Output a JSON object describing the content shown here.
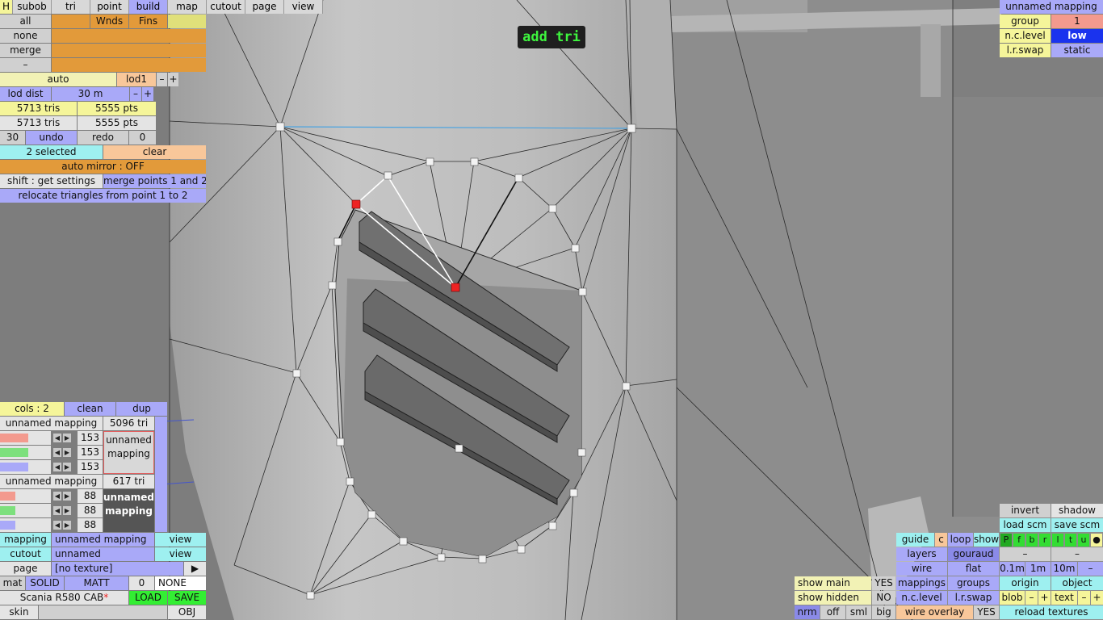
{
  "top_tabs": [
    {
      "label": "H",
      "w": 16
    },
    {
      "label": "subob",
      "w": 48
    },
    {
      "label": "tri",
      "w": 48
    },
    {
      "label": "point",
      "w": 48
    },
    {
      "label": "build",
      "w": 48
    },
    {
      "label": "map",
      "w": 48
    },
    {
      "label": "cutout",
      "w": 48
    },
    {
      "label": "page",
      "w": 48
    },
    {
      "label": "view",
      "w": 48
    }
  ],
  "active_tab": "build",
  "mode_banner": "add tri",
  "filter_rows": [
    {
      "label": "all",
      "c2": "Wnds",
      "c3": "Fins"
    },
    {
      "label": "none",
      "c2": "",
      "c3": ""
    },
    {
      "label": "merge",
      "c2": "",
      "c3": ""
    },
    {
      "label": "–",
      "c2": "",
      "c3": ""
    }
  ],
  "lod": {
    "auto": "auto",
    "level": "lod1",
    "minus": "–",
    "plus": "+",
    "dist_label": "lod dist",
    "dist_value": "30 m"
  },
  "stats": [
    {
      "tris": "5713 tris",
      "pts": "5555 pts"
    },
    {
      "tris": "5713 tris",
      "pts": "5555 pts"
    }
  ],
  "history": {
    "count": "30",
    "undo": "undo",
    "redo": "redo",
    "redo_count": "0"
  },
  "selection": {
    "selected": "2 selected",
    "clear": "clear"
  },
  "auto_mirror": "auto mirror : OFF",
  "shift_settings": "shift : get settings",
  "merge_points": "merge points 1 and 2",
  "relocate": "relocate triangles from point 1 to 2",
  "cols": {
    "label": "cols : 2",
    "clean": "clean",
    "dup": "dup"
  },
  "mapping_blocks": [
    {
      "name": "unnamed mapping",
      "tris": "5096 tri",
      "values": [
        "153",
        "153",
        "153"
      ],
      "preview": "unnamed\nmapping",
      "fills": [
        0.55,
        0.55,
        0.55
      ]
    },
    {
      "name": "unnamed mapping",
      "tris": "617 tri",
      "values": [
        "88",
        "88",
        "88"
      ],
      "preview": "unnamed\nmapping",
      "fills": [
        0.3,
        0.3,
        0.3
      ]
    }
  ],
  "bottom_left": {
    "mapping_label": "mapping",
    "mapping_value": "unnamed mapping",
    "view": "view",
    "cutout_label": "cutout",
    "cutout_value": "unnamed",
    "view2": "view",
    "page_label": "page",
    "page_value": "[no texture]",
    "page_arrow": "▶",
    "mat": "mat",
    "solid": "SOLID",
    "matt": "MATT",
    "mat_num": "0",
    "none": "NONE",
    "model": "Scania R580 CAB",
    "load": "LOAD",
    "save": "SAVE",
    "skin": "skin",
    "obj": "OBJ"
  },
  "top_right": {
    "title": "unnamed mapping",
    "group_label": "group",
    "group_value": "1",
    "nclevel_label": "n.c.level",
    "nclevel_value": "low",
    "lrswap_label": "l.r.swap",
    "lrswap_value": "static"
  },
  "bottom_right": {
    "invert": "invert",
    "shadow": "shadow",
    "load_scm": "load scm",
    "save_scm": "save scm",
    "guide": "guide",
    "c": "c",
    "loop": "loop",
    "show": "show",
    "letters": [
      "P",
      "f",
      "b",
      "r",
      "l",
      "t",
      "u",
      "●"
    ],
    "layers": "layers",
    "gouraud": "gouraud",
    "dash1": "–",
    "dash2": "–",
    "wire": "wire",
    "flat": "flat",
    "z1": "0.1m",
    "z2": "1m",
    "z3": "10m",
    "zm": "–",
    "mappings": "mappings",
    "groups": "groups",
    "origin": "origin",
    "object": "object",
    "show_main": "show main",
    "show_main_v": "YES",
    "show_hidden": "show hidden",
    "show_hidden_v": "NO",
    "nclevel": "n.c.level",
    "lrswap": "l.r.swap",
    "blob": "blob",
    "blob_minus": "–",
    "blob_plus": "+",
    "text": "text",
    "text_minus": "–",
    "text_plus": "+",
    "nrm": "nrm",
    "off": "off",
    "sml": "sml",
    "big": "big",
    "wire_overlay": "wire overlay",
    "wire_overlay_v": "YES",
    "reload": "reload textures"
  },
  "colors": {
    "selected_point": "#ee2222",
    "edge_highlight": "#4aa3e0",
    "vertex": "#f2f2f2"
  }
}
